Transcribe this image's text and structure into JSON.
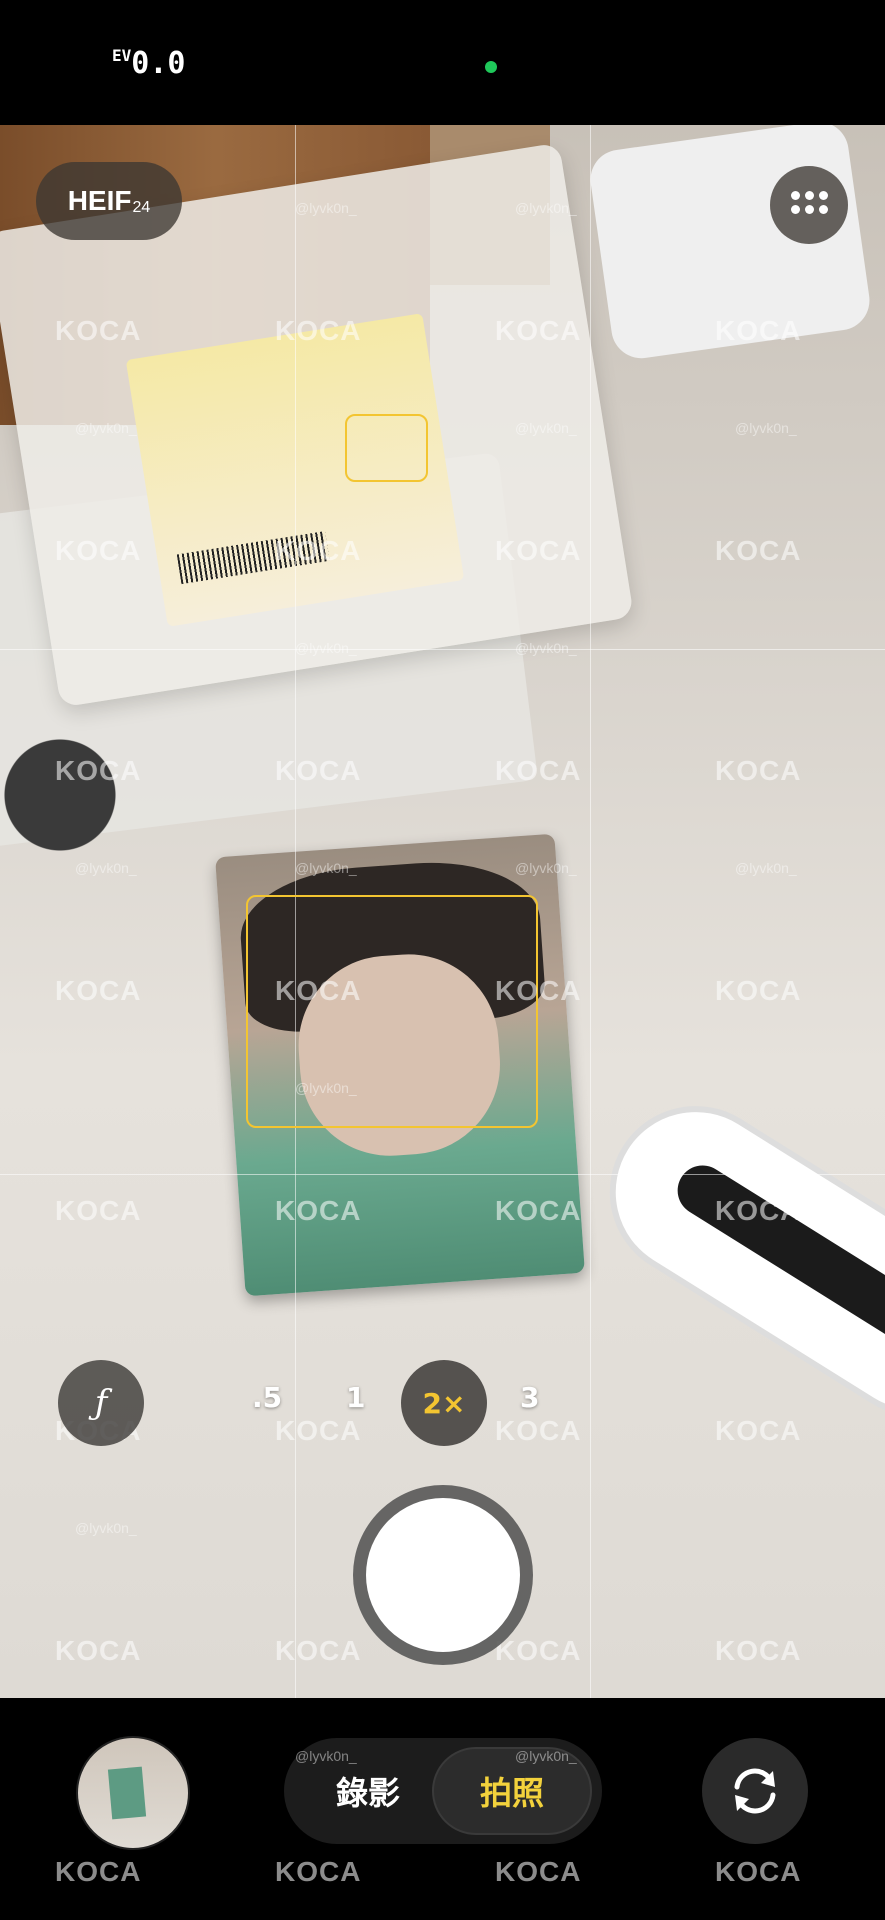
{
  "status": {
    "ev_label": "EV",
    "ev_value": "0.0",
    "indicator_color": "#1fc85a"
  },
  "format": {
    "label": "HEIF",
    "bit_depth": "24"
  },
  "settings_button": {
    "icon": "grid-dots-icon"
  },
  "aperture_button": {
    "label": "ƒ"
  },
  "zoom": {
    "options": [
      ".5",
      "1",
      "2×",
      "3"
    ],
    "selected": "2×"
  },
  "modes": {
    "video": "錄影",
    "photo": "拍照",
    "selected": "拍照"
  },
  "watermark": {
    "logo": "KOCA",
    "handle": "@lyvk0n_"
  },
  "colors": {
    "accent": "#f3c531",
    "mode_active": "#f3d23c"
  }
}
